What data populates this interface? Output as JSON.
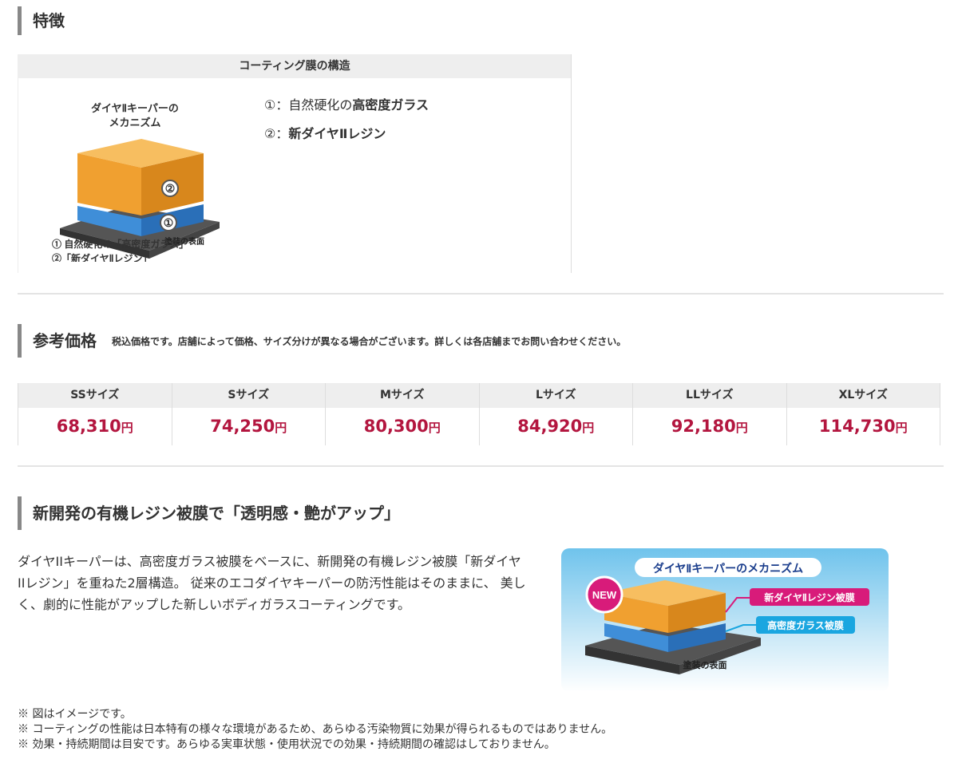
{
  "features": {
    "heading": "特徴",
    "table_title": "コーティング膜の構造",
    "diagram": {
      "title_line1": "ダイヤⅡキーパーの",
      "title_line2": "メカニズム",
      "layer_top": "②",
      "layer_bottom": "①",
      "base_label": "塗装の表面",
      "caption1": "① 自然硬化の「高密度ガラス」",
      "caption2": "②「新ダイヤⅡレジン」"
    },
    "items": [
      {
        "prefix": "①：自然硬化の",
        "emphasis": "高密度ガラス"
      },
      {
        "prefix": "②：",
        "emphasis": "新ダイヤⅡレジン"
      }
    ]
  },
  "price": {
    "heading": "参考価格",
    "note": "税込価格です。店舗によって価格、サイズ分けが異なる場合がございます。詳しくは各店舗までお問い合わせください。",
    "yen": "円",
    "columns": [
      {
        "size": "SSサイズ",
        "value": "68,310"
      },
      {
        "size": "Sサイズ",
        "value": "74,250"
      },
      {
        "size": "Mサイズ",
        "value": "80,300"
      },
      {
        "size": "Lサイズ",
        "value": "84,920"
      },
      {
        "size": "LLサイズ",
        "value": "92,180"
      },
      {
        "size": "XLサイズ",
        "value": "114,730"
      }
    ]
  },
  "resin": {
    "heading": "新開発の有機レジン被膜で「透明感・艶がアップ」",
    "paragraph": "ダイヤIIキーパーは、高密度ガラス被膜をベースに、新開発の有機レジン被膜「新ダイヤIIレジン」を重ねた2層構造。 従来のエコダイヤキーパーの防汚性能はそのままに、 美しく、劇的に性能がアップした新しいボディガラスコーティングです。",
    "diagram": {
      "title": "ダイヤⅡキーパーのメカニズム",
      "badge": "NEW",
      "label_resin": "新ダイヤⅡレジン被膜",
      "label_glass": "高密度ガラス被膜",
      "base_label": "塗装の表面"
    }
  },
  "notes": [
    "※ 図はイメージです。",
    "※ コーティングの性能は日本特有の様々な環境があるため、あらゆる汚染物質に効果が得られるものではありません。",
    "※ 効果・持続期間は目安です。あらゆる実車状態・使用状況での効果・持続期間の確認はしておりません。"
  ],
  "colors": {
    "price_red": "#b3163f",
    "layer_orange": "#f0a030",
    "layer_blue": "#3f8ed8",
    "badge_magenta": "#d81b7a",
    "label_cyan": "#1aa6e0"
  }
}
